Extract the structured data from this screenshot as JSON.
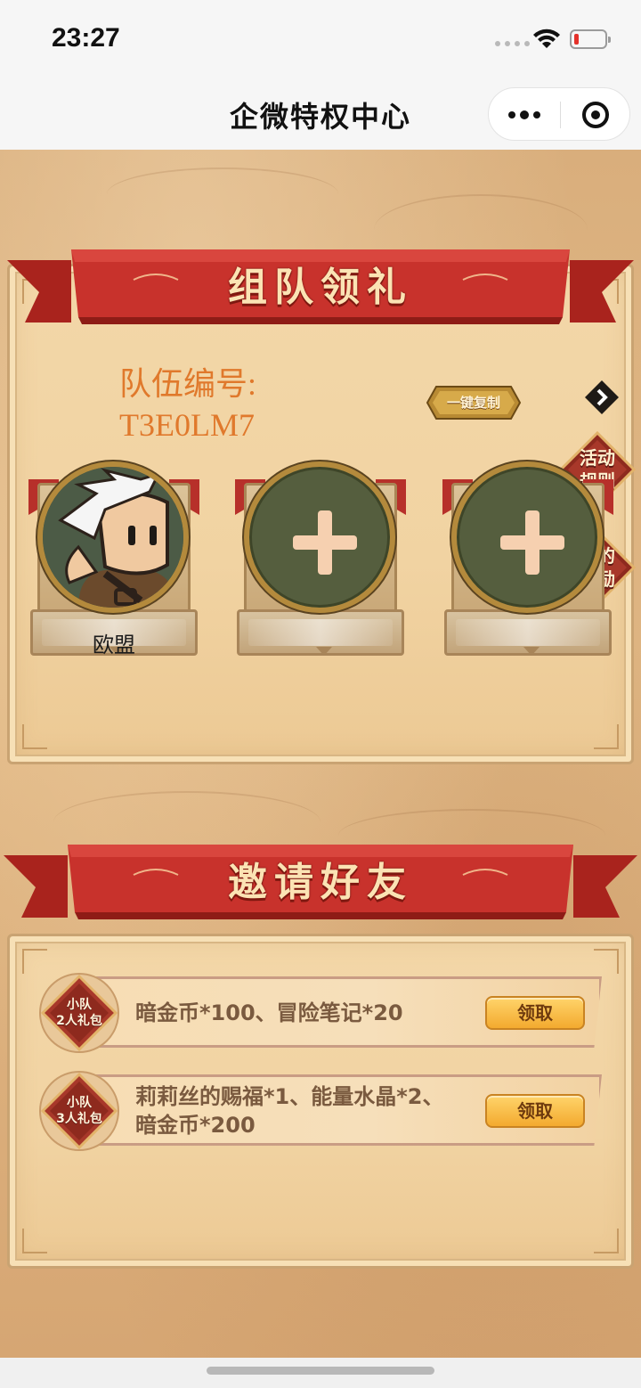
{
  "status_bar": {
    "time": "23:27"
  },
  "nav": {
    "title": "企微特权中心"
  },
  "team_section": {
    "banner_title": "组队领礼",
    "team_id_label": "队伍编号:",
    "team_id": "T3E0LM7",
    "copy_button": "一键复制",
    "rules_button_line1": "活动",
    "rules_button_line2": "规则",
    "rewards_button_line1": "我的",
    "rewards_button_line2": "奖励",
    "members": [
      {
        "name": "欧盟",
        "filled": true
      },
      {
        "name": "",
        "filled": false
      },
      {
        "name": "",
        "filled": false
      }
    ]
  },
  "invite_section": {
    "banner_title": "邀请好友",
    "gifts": [
      {
        "badge_line1": "小队",
        "badge_line2": "2人礼包",
        "rewards": "暗金币*100、冒险笔记*20",
        "button": "领取"
      },
      {
        "badge_line1": "小队",
        "badge_line2": "3人礼包",
        "rewards": "莉莉丝的赐福*1、能量水晶*2、暗金币*200",
        "button": "领取"
      }
    ]
  },
  "colors": {
    "banner_red": "#c8322c",
    "team_id_orange": "#e0792c",
    "claim_button": "#f3aa2f",
    "slot_green": "#555e3e"
  },
  "icons": [
    "wifi-icon",
    "battery-icon",
    "more-icon",
    "close-capsule-icon",
    "chevron-right-icon",
    "plus-icon",
    "avatar"
  ]
}
